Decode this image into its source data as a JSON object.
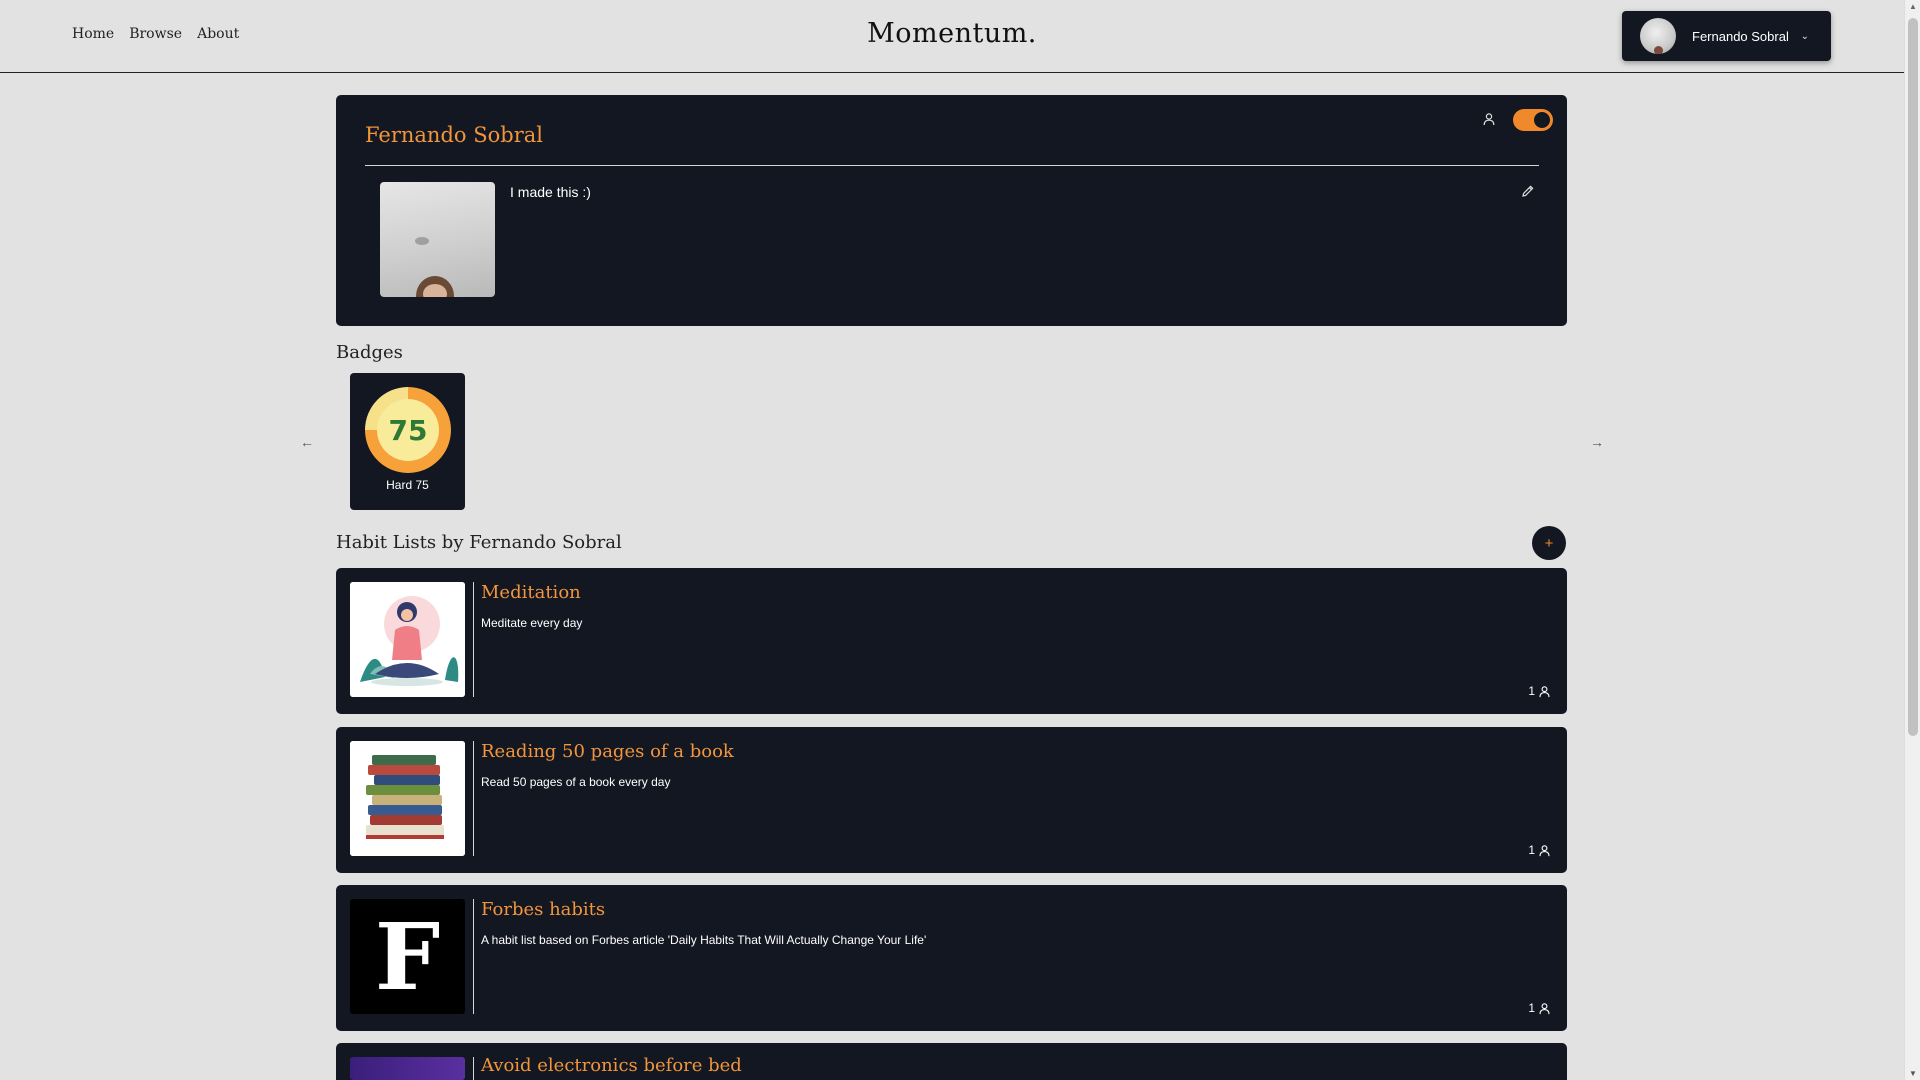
{
  "header": {
    "nav": [
      "Home",
      "Browse",
      "About"
    ],
    "brand": "Momentum.",
    "user_name": "Fernando Sobral"
  },
  "profile": {
    "name": "Fernando Sobral",
    "bio": "I made this :)",
    "private_toggle_on": true
  },
  "badges": {
    "title": "Badges",
    "items": [
      {
        "label": "Hard 75",
        "icon_text": "75"
      }
    ]
  },
  "habit_lists": {
    "title": "Habit Lists by Fernando Sobral",
    "add_label": "+",
    "items": [
      {
        "title": "Meditation",
        "description": "Meditate every day",
        "followers": "1",
        "image": "meditation-illustration"
      },
      {
        "title": "Reading 50 pages of a book",
        "description": "Read 50 pages of a book every day",
        "followers": "1",
        "image": "books-stack"
      },
      {
        "title": "Forbes habits",
        "description": "A habit list based on Forbes article 'Daily Habits That Will Actually Change Your Life'",
        "followers": "1",
        "image": "forbes-logo",
        "image_text": "F"
      },
      {
        "title": "Avoid electronics before bed",
        "description": "",
        "followers": "",
        "image": "purple-illustration"
      }
    ]
  },
  "colors": {
    "accent": "#f2953b",
    "card": "#131722",
    "background": "#e2e2e2"
  }
}
